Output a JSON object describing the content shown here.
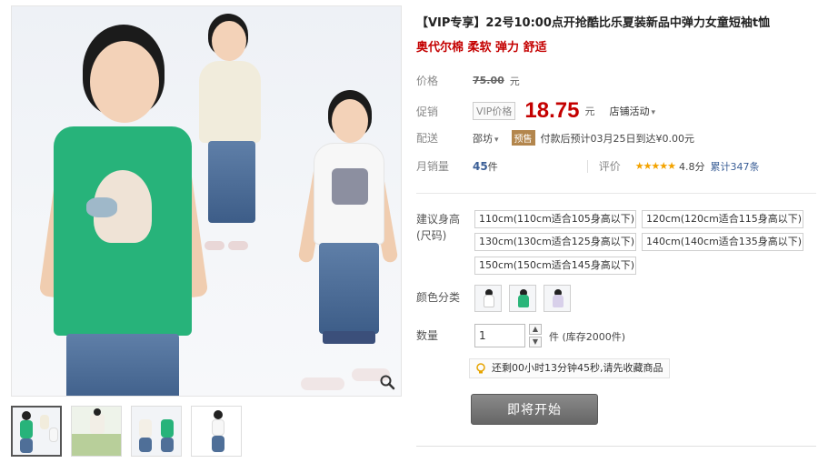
{
  "product": {
    "title": "【VIP专享】22号10:00点开抢酷比乐夏装新品中弹力女童短袖t恤",
    "subtitle": "奥代尔棉 柔软 弹力 舒适"
  },
  "price": {
    "label": "价格",
    "original": "75.00",
    "unit": "元"
  },
  "promo": {
    "label": "促销",
    "vip_tag": "VIP价格",
    "price": "18.75",
    "unit": "元",
    "store_activity": "店铺活动"
  },
  "delivery": {
    "label": "配送",
    "location": "邵坊",
    "presale_tag": "预售",
    "note": "付款后预计03月25日到达",
    "fee": "¥0.00元"
  },
  "sales": {
    "label": "月销量",
    "count": "45",
    "unit": "件",
    "review_label": "评价",
    "stars": "★★★★★",
    "score": "4.8分",
    "total": "累计347条"
  },
  "sizes": {
    "label": "建议身高(尺码)",
    "options": [
      "110cm(110cm适合105身高以下)",
      "120cm(120cm适合115身高以下)",
      "130cm(130cm适合125身高以下)",
      "140cm(140cm适合135身高以下)",
      "150cm(150cm适合145身高以下)"
    ]
  },
  "colors": {
    "label": "颜色分类",
    "swatches": [
      "#ffffff",
      "#2bb57a",
      "#e6e0f0"
    ]
  },
  "quantity": {
    "label": "数量",
    "value": "1",
    "stock": "件 (库存2000件)"
  },
  "countdown": {
    "text": "还剩00小时13分钟45秒,请先收藏商品"
  },
  "button": {
    "label": "即将开始"
  },
  "theme": {
    "price_red": "#c40000",
    "link_blue": "#3a5e96",
    "star_gold": "#f3a300"
  }
}
